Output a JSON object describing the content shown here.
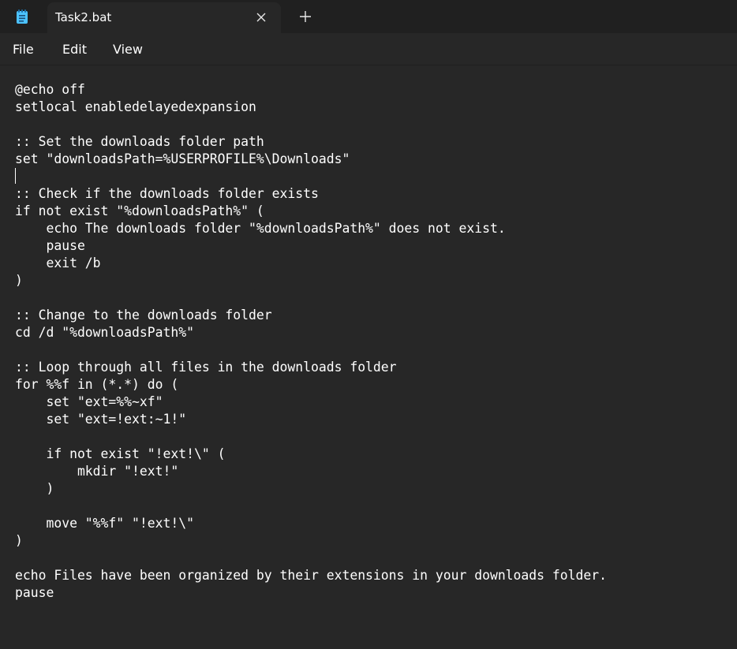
{
  "window": {
    "app_icon": "notepad-icon",
    "tab": {
      "title": "Task2.bat",
      "close_icon": "close-icon"
    },
    "new_tab_icon": "plus-icon"
  },
  "menu": {
    "items": [
      "File",
      "Edit",
      "View"
    ]
  },
  "editor": {
    "text": "@echo off\nsetlocal enabledelayedexpansion\n\n:: Set the downloads folder path\nset \"downloadsPath=%USERPROFILE%\\Downloads\"\n\n:: Check if the downloads folder exists\nif not exist \"%downloadsPath%\" (\n    echo The downloads folder \"%downloadsPath%\" does not exist.\n    pause\n    exit /b\n)\n\n:: Change to the downloads folder\ncd /d \"%downloadsPath%\"\n\n:: Loop through all files in the downloads folder\nfor %%f in (*.*) do (\n    set \"ext=%%~xf\"\n    set \"ext=!ext:~1!\"\n\n    if not exist \"!ext!\\\" (\n        mkdir \"!ext!\"\n    )\n\n    move \"%%f\" \"!ext!\\\"\n)\n\necho Files have been organized by their extensions in your downloads folder.\npause"
  },
  "colors": {
    "titlebar_bg": "#202020",
    "editor_bg": "#272727",
    "text": "#ffffff",
    "icon_accent": "#4cc2ff"
  }
}
